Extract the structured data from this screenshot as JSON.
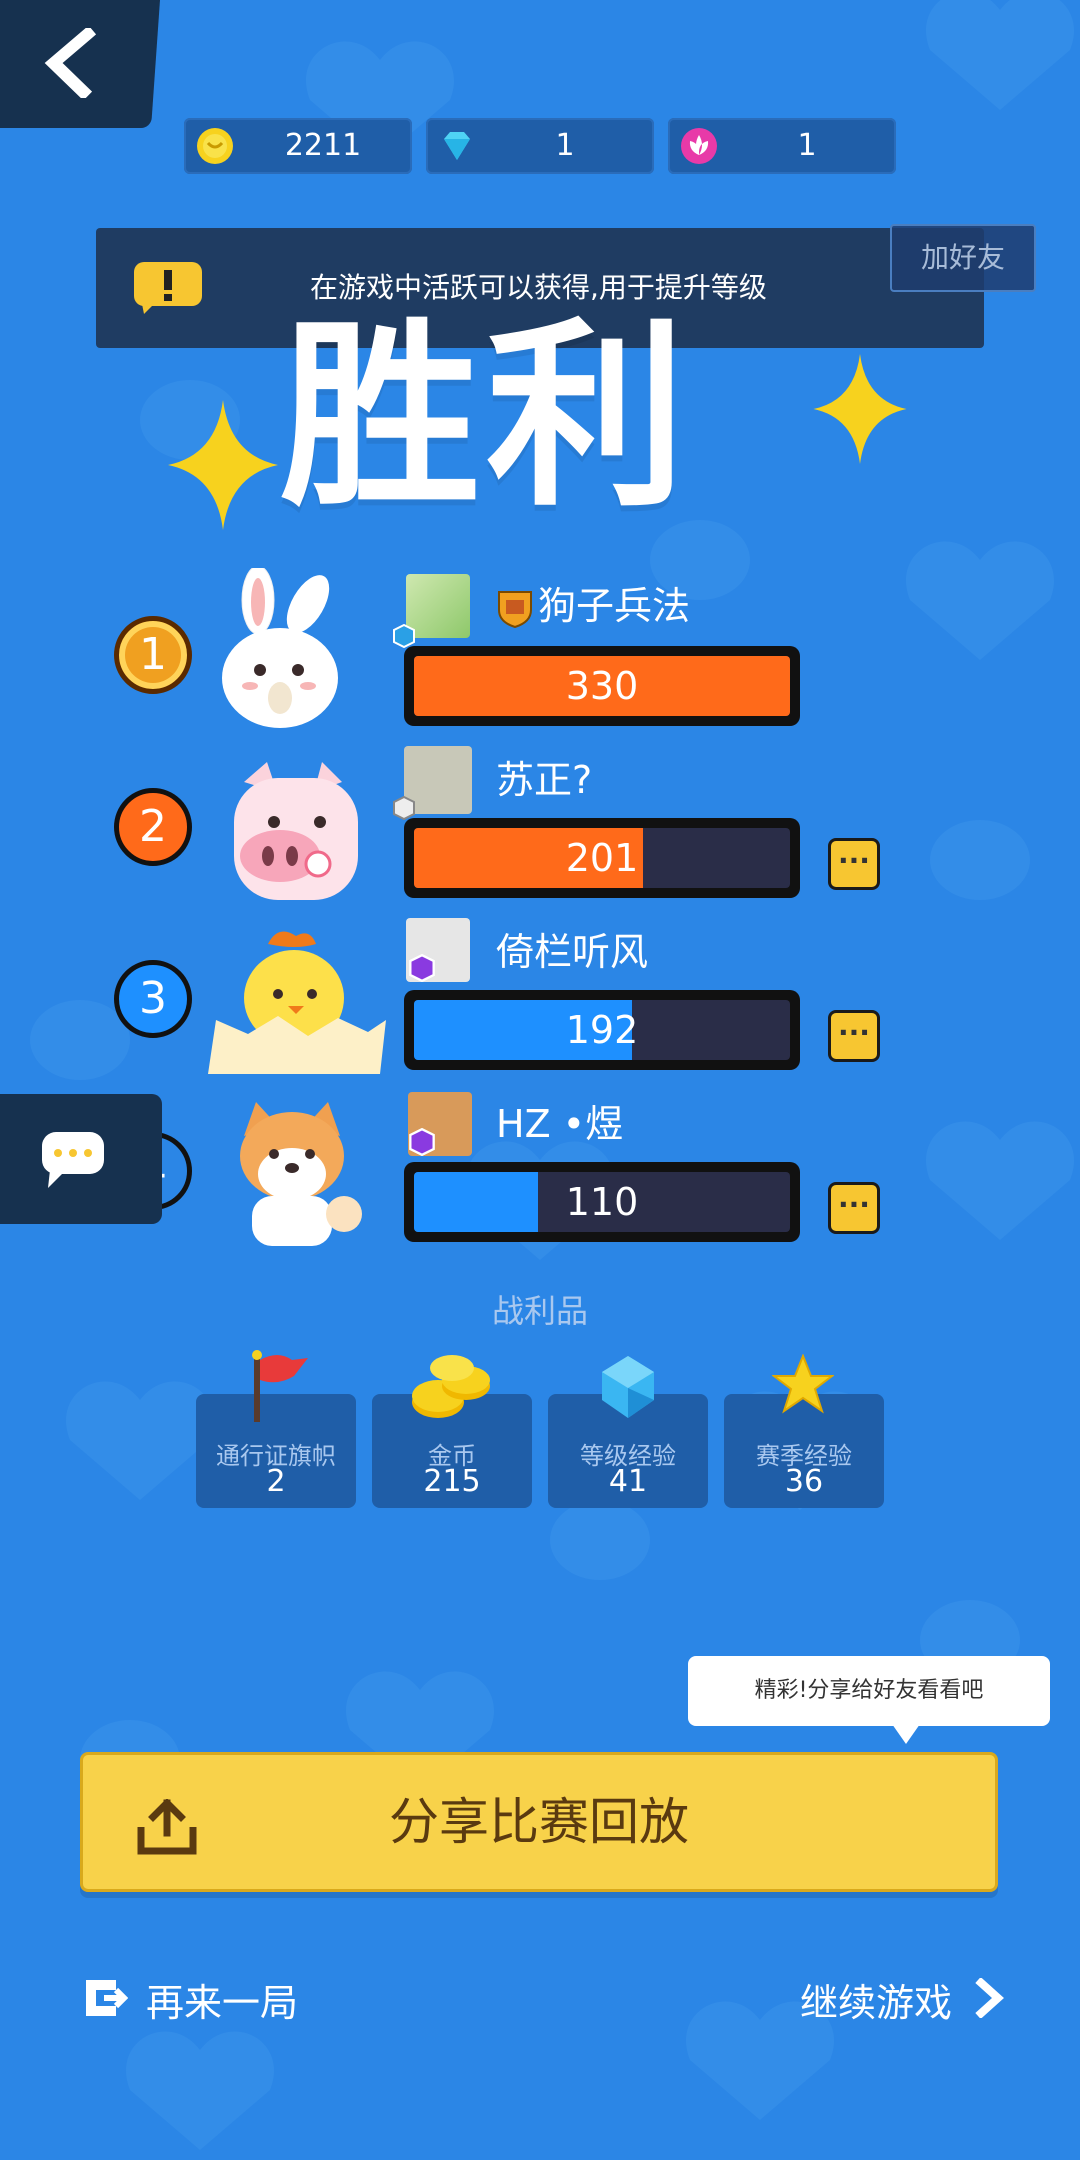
{
  "topbar": {
    "back_icon": "chevron-left-icon",
    "resources": [
      {
        "icon": "coin-icon",
        "value": "2211"
      },
      {
        "icon": "diamond-icon",
        "value": "1"
      },
      {
        "icon": "lotus-icon",
        "value": "1"
      }
    ]
  },
  "tip": {
    "icon": "alert-icon",
    "text": "在游戏中活跃可以获得,用于提升等级"
  },
  "add_friend": "加好友",
  "victory_title": "胜利",
  "players": [
    {
      "rank": "1",
      "name": "狗子兵法",
      "score": "330",
      "progress": 1.0,
      "bar_color": "#ff6a1a",
      "rank_color": "#f0a020",
      "character": "rabbit"
    },
    {
      "rank": "2",
      "name": "苏正?",
      "score": "201",
      "progress": 0.61,
      "bar_color": "#ff6a1a",
      "rank_color": "#ff6a1a",
      "character": "pig"
    },
    {
      "rank": "3",
      "name": "倚栏听风",
      "score": "192",
      "progress": 0.58,
      "bar_color": "#1e90ff",
      "rank_color": "#1e90ff",
      "character": "chick"
    },
    {
      "rank": "4",
      "name": "HZ •煜",
      "score": "110",
      "progress": 0.33,
      "bar_color": "#1e90ff",
      "rank_color": "#2b86e6",
      "character": "shiba"
    }
  ],
  "more_label": "···",
  "loot": {
    "title": "战利品",
    "items": [
      {
        "name": "通行证旗帜",
        "value": "2",
        "icon": "flag-icon"
      },
      {
        "name": "金币",
        "value": "215",
        "icon": "coins-icon"
      },
      {
        "name": "等级经验",
        "value": "41",
        "icon": "crystal-icon"
      },
      {
        "name": "赛季经验",
        "value": "36",
        "icon": "star-icon"
      }
    ]
  },
  "share_bubble": "精彩!分享给好友看看吧",
  "share_button": "分享比赛回放",
  "bottom": {
    "again": "再来一局",
    "continue": "继续游戏"
  }
}
